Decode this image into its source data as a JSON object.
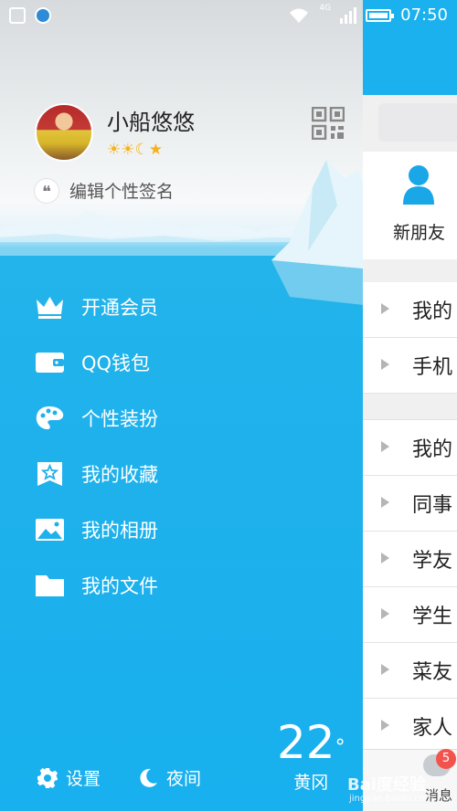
{
  "status_bar": {
    "time": "07:50",
    "network": "4G"
  },
  "profile": {
    "username": "小船悠悠",
    "level_badges": "☀☀☾★",
    "signature_placeholder": "编辑个性签名"
  },
  "menu": [
    {
      "label": "开通会员",
      "icon": "crown-icon"
    },
    {
      "label": "QQ钱包",
      "icon": "wallet-icon"
    },
    {
      "label": "个性装扮",
      "icon": "palette-icon"
    },
    {
      "label": "我的收藏",
      "icon": "star-bookmark-icon"
    },
    {
      "label": "我的相册",
      "icon": "photo-album-icon"
    },
    {
      "label": "我的文件",
      "icon": "folder-icon"
    }
  ],
  "bottom": {
    "settings": "设置",
    "night": "夜间"
  },
  "weather": {
    "temperature": "22",
    "unit": "°",
    "wind": "黄冈"
  },
  "contacts_panel": {
    "new_friend": "新朋友",
    "groups_a": [
      "我的",
      "手机"
    ],
    "groups_b": [
      "我的",
      "同事",
      "学友",
      "学生",
      "菜友",
      "家人"
    ],
    "messages_label": "消息",
    "messages_badge": "5"
  },
  "watermark": {
    "brand": "Bai度经验",
    "url": "jingyan.baidu.com"
  },
  "colors": {
    "accent": "#1ab1ee",
    "badge": "#f2544d"
  }
}
